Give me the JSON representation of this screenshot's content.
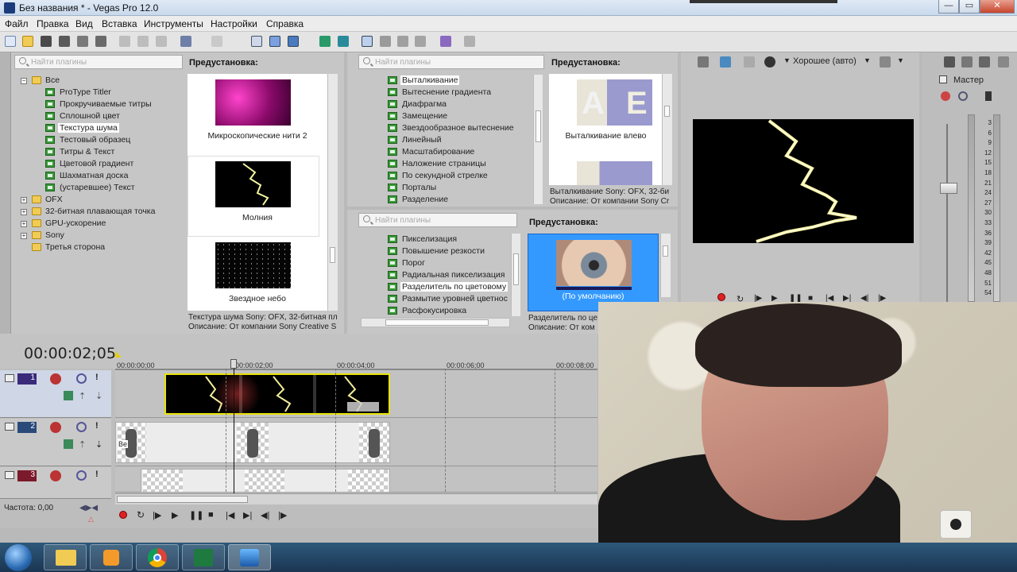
{
  "window": {
    "title": "Без названия * - Vegas Pro 12.0",
    "controls": [
      "—",
      "▭",
      "✕"
    ]
  },
  "menu": [
    "Файл",
    "Правка",
    "Вид",
    "Вставка",
    "Инструменты",
    "Настройки",
    "Справка"
  ],
  "plugin_panel_left": {
    "search_placeholder": "Найти плагины",
    "tree": [
      {
        "label": "Все",
        "type": "folder"
      },
      {
        "label": "ProType Titler",
        "type": "fx"
      },
      {
        "label": "Прокручиваемые титры",
        "type": "fx"
      },
      {
        "label": "Сплошной цвет",
        "type": "fx"
      },
      {
        "label": "Текстура шума",
        "type": "fx",
        "selected": true
      },
      {
        "label": "Тестовый образец",
        "type": "fx"
      },
      {
        "label": "Титры & Текст",
        "type": "fx"
      },
      {
        "label": "Цветовой градиент",
        "type": "fx"
      },
      {
        "label": "Шахматная доска",
        "type": "fx"
      },
      {
        "label": "(устаревшее) Текст",
        "type": "fx"
      },
      {
        "label": "OFX",
        "type": "folder"
      },
      {
        "label": "32-битная плавающая точка",
        "type": "folder"
      },
      {
        "label": "GPU-ускорение",
        "type": "folder"
      },
      {
        "label": "Sony",
        "type": "folder"
      },
      {
        "label": "Третья сторона",
        "type": "folder"
      }
    ],
    "presets_header": "Предустановка:",
    "presets": [
      "Микроскопические нити 2",
      "Молния",
      "Звездное небо"
    ],
    "desc_line1": "Текстура шума Sony: OFX, 32-битная пл",
    "desc_line2": "Описание: От компании Sony Creative S"
  },
  "plugin_panel_mid_top": {
    "search_placeholder": "Найти плагины",
    "items": [
      "Выталкивание",
      "Вытеснение градиента",
      "Диафрагма",
      "Замещение",
      "Звездообразное вытеснение",
      "Линейный",
      "Масштабирование",
      "Наложение страницы",
      "По секундной стрелке",
      "Порталы",
      "Разделение"
    ],
    "presets_header": "Предустановка:",
    "presets": [
      "Выталкивание влево"
    ],
    "desc_line1": "Выталкивание Sony: OFX, 32-би",
    "desc_line2": "Описание: От компании Sony Cr"
  },
  "plugin_panel_mid_bottom": {
    "search_placeholder": "Найти плагины",
    "items": [
      "Пикселизация",
      "Повышение резкости",
      "Порог",
      "Радиальная пикселизация",
      "Разделитель по цветовому",
      "Размытие уровней цветнос",
      "Расфокусировка"
    ],
    "presets_header": "Предустановка:",
    "presets": [
      "(По умолчанию)"
    ],
    "desc_line1": "Разделитель по це",
    "desc_line2": "Описание: От ком"
  },
  "preview": {
    "quality": "Хорошее (авто)"
  },
  "mixer": {
    "title": "Мастер",
    "scale": [
      "3",
      "6",
      "9",
      "12",
      "15",
      "18",
      "21",
      "24",
      "27",
      "30",
      "33",
      "36",
      "39",
      "42",
      "45",
      "48",
      "51",
      "54"
    ]
  },
  "timeline": {
    "timecode": "00:00:02;05",
    "ruler": [
      "00:00:00;00",
      "00:00:02;00",
      "00:00:04;00",
      "00:00:06;00",
      "00:00:08;00"
    ],
    "tracks": [
      "1",
      "2",
      "3"
    ],
    "clip_label": "Ве",
    "rate_label": "Частота: 0,00"
  },
  "colors": {
    "track1": "#3a2a7a",
    "track2": "#2a4a7a",
    "track3": "#7a1a2a",
    "accent": "#3399ff"
  }
}
